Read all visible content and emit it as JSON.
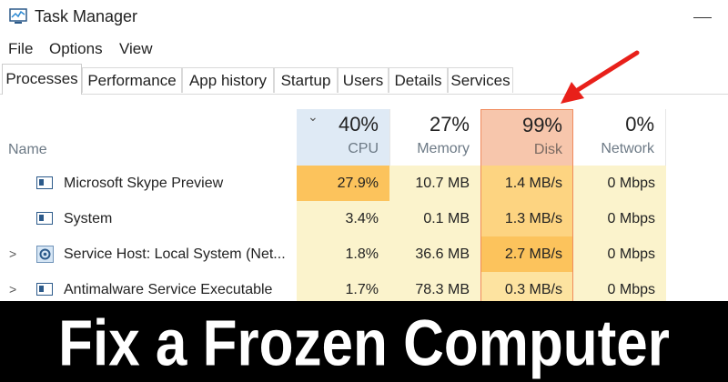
{
  "window": {
    "title": "Task Manager"
  },
  "menu": [
    "File",
    "Options",
    "View"
  ],
  "tabs": [
    "Processes",
    "Performance",
    "App history",
    "Startup",
    "Users",
    "Details",
    "Services"
  ],
  "active_tab": "Processes",
  "columns": {
    "name": {
      "label": "Name"
    },
    "cpu": {
      "pct": "40%",
      "label": "CPU"
    },
    "memory": {
      "pct": "27%",
      "label": "Memory"
    },
    "disk": {
      "pct": "99%",
      "label": "Disk"
    },
    "network": {
      "pct": "0%",
      "label": "Network"
    }
  },
  "rows": [
    {
      "name": "Microsoft Skype Preview",
      "cpu": "27.9%",
      "memory": "10.7 MB",
      "disk": "1.4 MB/s",
      "network": "0 Mbps"
    },
    {
      "name": "System",
      "cpu": "3.4%",
      "memory": "0.1 MB",
      "disk": "1.3 MB/s",
      "network": "0 Mbps"
    },
    {
      "name": "Service Host: Local System (Net...",
      "cpu": "1.8%",
      "memory": "36.6 MB",
      "disk": "2.7 MB/s",
      "network": "0 Mbps"
    },
    {
      "name": "Antimalware Service Executable",
      "cpu": "1.7%",
      "memory": "78.3 MB",
      "disk": "0.3 MB/s",
      "network": "0 Mbps"
    }
  ],
  "banner": {
    "text": "Fix a Frozen Computer"
  },
  "colors": {
    "cpu_header": "#dfeaf5",
    "disk_header": "#f7c6ac",
    "heat_light": "#fbf3cc",
    "heat_mid": "#fde3a0",
    "heat_high": "#fdd481",
    "heat_hot": "#fcc35c",
    "arrow": "#e8201a"
  }
}
